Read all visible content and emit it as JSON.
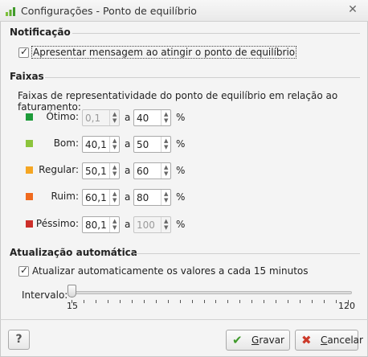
{
  "window": {
    "title": "Configurações - Ponto de equilíbrio"
  },
  "notification": {
    "heading": "Notificação",
    "checkbox_label": "Apresentar mensagem ao atingir o ponto de equilíbrio",
    "checked": true
  },
  "ranges": {
    "heading": "Faixas",
    "description": "Faixas de representatividade do ponto de equilíbrio em relação ao faturamento:",
    "separator": "a",
    "unit": "%",
    "rows": [
      {
        "label": "Ótimo:",
        "color": "#1e9b3a",
        "from": "0,1",
        "to": "40",
        "from_disabled": true,
        "to_disabled": false
      },
      {
        "label": "Bom:",
        "color": "#8cc43c",
        "from": "40,1",
        "to": "50",
        "from_disabled": false,
        "to_disabled": false
      },
      {
        "label": "Regular:",
        "color": "#f5a623",
        "from": "50,1",
        "to": "60",
        "from_disabled": false,
        "to_disabled": false
      },
      {
        "label": "Ruim:",
        "color": "#f06a1e",
        "from": "60,1",
        "to": "80",
        "from_disabled": false,
        "to_disabled": false
      },
      {
        "label": "Péssimo:",
        "color": "#cc2f2a",
        "from": "80,1",
        "to": "100",
        "from_disabled": false,
        "to_disabled": true
      }
    ]
  },
  "auto_update": {
    "heading": "Atualização automática",
    "checkbox_label": "Atualizar automaticamente os valores a cada 15 minutos",
    "checked": true,
    "interval_label": "Intervalo:",
    "min": "15",
    "max": "120",
    "value": 15
  },
  "footer": {
    "help_label": "?",
    "save_label": "Gravar",
    "cancel_label": "Cancelar"
  }
}
